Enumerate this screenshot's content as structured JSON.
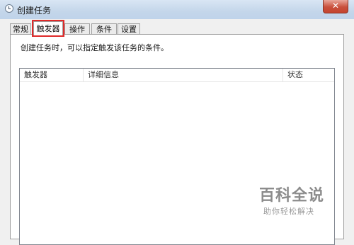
{
  "window": {
    "title": "创建任务",
    "close_label": "✕"
  },
  "tabs": [
    {
      "label": "常规"
    },
    {
      "label": "触发器"
    },
    {
      "label": "操作"
    },
    {
      "label": "条件"
    },
    {
      "label": "设置"
    }
  ],
  "active_tab": "触发器",
  "triggers_panel": {
    "description": "创建任务时，可以指定触发该任务的条件。",
    "columns": [
      "触发器",
      "详细信息",
      "状态"
    ],
    "rows": []
  },
  "watermark": {
    "main": "百科全说",
    "sub": "助你轻松解决"
  },
  "colors": {
    "highlight": "#e02a2a",
    "titlebar": "#c4d6ea"
  }
}
